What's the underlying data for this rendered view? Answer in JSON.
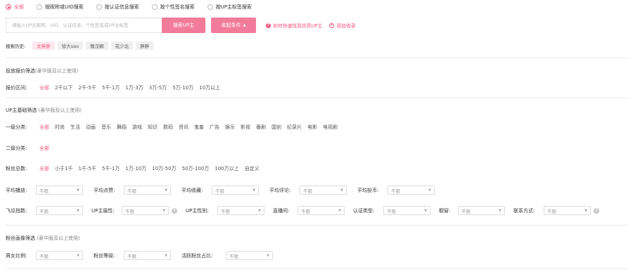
{
  "search_modes": [
    {
      "label": "全部",
      "active": true
    },
    {
      "label": "按昵称或UID搜索",
      "active": false
    },
    {
      "label": "按认证信息搜索",
      "active": false
    },
    {
      "label": "按个性签名搜索",
      "active": false
    },
    {
      "label": "按UP主标签搜索",
      "active": false
    }
  ],
  "search": {
    "placeholder": "请输入UP主昵称、UID、认证信息、个性签名或UP主标签",
    "search_button": "搜索UP主",
    "filter_button": "收起条件",
    "filter_caret": "▲",
    "help_link": "如何快速找到优质UP主",
    "add_collection": "添加收录"
  },
  "history": {
    "label": "搜索历史:",
    "tags": [
      "女胖胖",
      "徐大sao",
      "敬汉卿",
      "花少北",
      "胖胖"
    ]
  },
  "price_section": {
    "title": "投放报价筛选",
    "subtitle": "(豪华版及以上使用)",
    "label": "报价区间:",
    "options": [
      "全部",
      "2千以下",
      "2千-5千",
      "5千-1万",
      "1万-3万",
      "3万-5万",
      "5万-10万",
      "10万以上"
    ]
  },
  "basic_section": {
    "title": "UP主基础筛选",
    "subtitle": "(豪华版及以上使用)",
    "cat1_label": "一级分类:",
    "cat1_options": [
      "全部",
      "时尚",
      "生活",
      "动画",
      "音乐",
      "舞蹈",
      "游戏",
      "知识",
      "数码",
      "资讯",
      "鬼畜",
      "广告",
      "娱乐",
      "影视",
      "番剧",
      "国创",
      "纪录片",
      "电影",
      "电视剧"
    ],
    "cat2_label": "二级分类:",
    "cat2_options": [
      "全部"
    ],
    "fans_label": "粉丝总数:",
    "fans_options": [
      "全部",
      "小于1千",
      "1千-5千",
      "5千-1万",
      "1万-10万",
      "10万-50万",
      "50万-100万",
      "100万以上",
      "自定义"
    ],
    "select_default": "不限",
    "selects_row1": [
      {
        "label": "平均播放:"
      },
      {
        "label": "平均点赞:"
      },
      {
        "label": "平均收藏:"
      },
      {
        "label": "平均评论:"
      },
      {
        "label": "平均投币:"
      }
    ],
    "selects_row2": [
      {
        "label": "飞瓜指数:",
        "help": false
      },
      {
        "label": "UP主属性:",
        "help": true
      },
      {
        "label": "UP主性别:",
        "help": false
      },
      {
        "label": "直播间:",
        "help": false
      },
      {
        "label": "认证类型:",
        "help": false
      },
      {
        "label": "橱窗:",
        "help": false
      },
      {
        "label": "联系方式:",
        "help": true
      }
    ]
  },
  "fans_section": {
    "title": "粉丝画像筛选",
    "subtitle": "(豪华版及以上使用)",
    "selects": [
      {
        "label": "男女比例:"
      },
      {
        "label": "粉丝等级:"
      },
      {
        "label": "活跃粉丝占比:"
      }
    ]
  },
  "colors": {
    "accent": "#f5577f",
    "button": "#f27b9a"
  },
  "icons": {
    "question": "?",
    "plus": "+",
    "help": "?",
    "chevron": "▼"
  }
}
